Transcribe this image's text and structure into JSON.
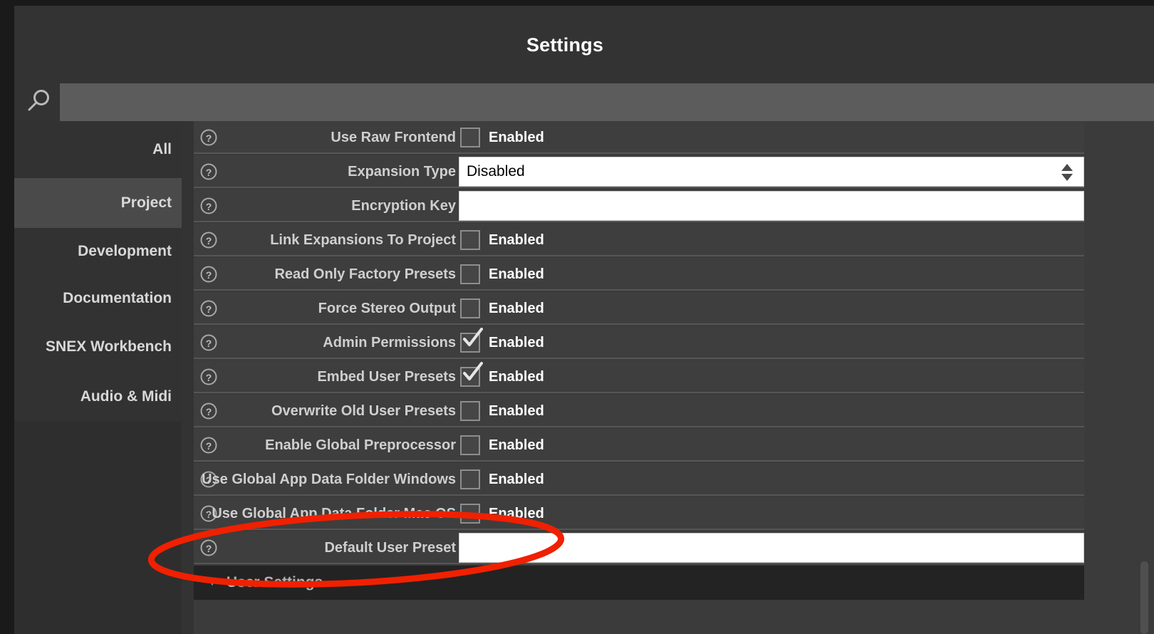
{
  "window": {
    "title": "Settings"
  },
  "search": {
    "icon": "search-icon",
    "value": "",
    "placeholder": ""
  },
  "sidebar": {
    "items": [
      {
        "label": "All",
        "selected": false
      },
      {
        "label": "Project",
        "selected": true
      },
      {
        "label": "Development",
        "selected": false
      },
      {
        "label": "Documentation",
        "selected": false
      },
      {
        "label": "SNEX Workbench",
        "selected": false
      },
      {
        "label": "Audio & Midi",
        "selected": false
      }
    ]
  },
  "settings": {
    "help_icon": "question-mark-circle-icon",
    "enabled_label": "Enabled",
    "rows": [
      {
        "label": "Use Raw Frontend",
        "type": "checkbox",
        "checked": false
      },
      {
        "label": "Expansion Type",
        "type": "combo",
        "value": "Disabled"
      },
      {
        "label": "Encryption Key",
        "type": "text",
        "value": ""
      },
      {
        "label": "Link Expansions To Project",
        "type": "checkbox",
        "checked": false
      },
      {
        "label": "Read Only Factory Presets",
        "type": "checkbox",
        "checked": false
      },
      {
        "label": "Force Stereo Output",
        "type": "checkbox",
        "checked": false
      },
      {
        "label": "Admin Permissions",
        "type": "checkbox",
        "checked": true
      },
      {
        "label": "Embed User Presets",
        "type": "checkbox",
        "checked": true
      },
      {
        "label": "Overwrite Old User Presets",
        "type": "checkbox",
        "checked": false
      },
      {
        "label": "Enable Global Preprocessor",
        "type": "checkbox",
        "checked": false
      },
      {
        "label": "Use Global App Data Folder Windows",
        "type": "checkbox",
        "checked": false
      },
      {
        "label": "Use Global App Data Folder Mac OS",
        "type": "checkbox",
        "checked": false
      },
      {
        "label": "Default User Preset",
        "type": "text",
        "value": ""
      }
    ]
  },
  "group_footer": {
    "caret": "triangle-down-icon",
    "label": "User Settings"
  },
  "scrollbar": {
    "name": "vertical-scrollbar"
  },
  "annotation": {
    "shape": "ellipse",
    "color": "#f02000"
  },
  "colors": {
    "window_bg": "#333333",
    "row_bg": "#3e3e3e",
    "selected_tab": "#4a4a4a",
    "accent_annotation": "#f02000",
    "field_bg": "#ffffff"
  }
}
